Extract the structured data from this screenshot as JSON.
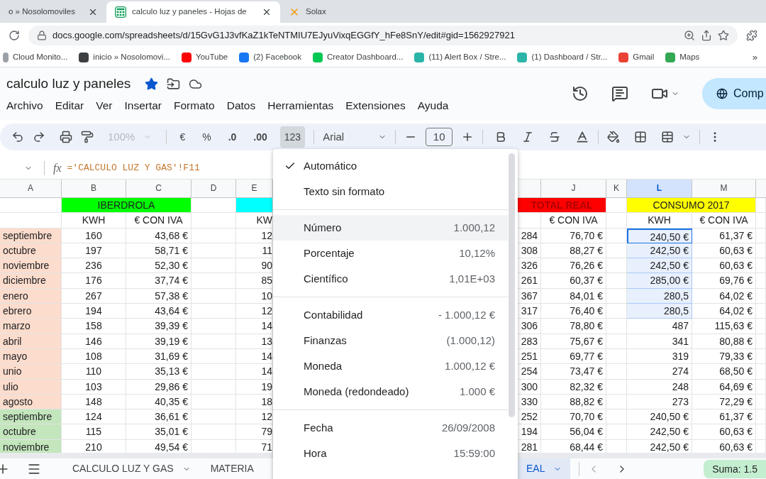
{
  "browser_tabs": [
    {
      "title": "o » Nosolomoviles",
      "selected": false
    },
    {
      "title": "calculo luz y paneles - Hojas de",
      "selected": true
    },
    {
      "title": "Solax",
      "selected": false
    }
  ],
  "address": "docs.google.com/spreadsheets/d/15GvG1J3vfKaZ1kTeNTMIU7EJyuVixqEGGfY_hFe8SnY/edit#gid=1562927921",
  "bookmarks": [
    {
      "label": "Cloud Monito...",
      "color": "#9aa0a6"
    },
    {
      "label": "inicio » Nosolomovi...",
      "color": "#3c4043"
    },
    {
      "label": "YouTube",
      "color": "#ff0000"
    },
    {
      "label": "(2) Facebook",
      "color": "#1877f2"
    },
    {
      "label": "Creator Dashboard...",
      "color": "#00c853"
    },
    {
      "label": "(11) Alert Box / Stre...",
      "color": "#2bb5a8"
    },
    {
      "label": "(1) Dashboard / Str...",
      "color": "#2bb5a8"
    },
    {
      "label": "Gmail",
      "color": "#ea4335"
    },
    {
      "label": "Maps",
      "color": "#34a853"
    }
  ],
  "bookmarks_more": "»",
  "doc": {
    "title": "calculo luz y paneles",
    "starred": true,
    "share_label": "Comp"
  },
  "menu_bar": [
    "Archivo",
    "Editar",
    "Ver",
    "Insertar",
    "Formato",
    "Datos",
    "Herramientas",
    "Extensiones",
    "Ayuda"
  ],
  "toolbar": {
    "zoom": {
      "label": "100%",
      "disabled": true
    },
    "format_buttons": [
      {
        "label": "€",
        "selected": false
      },
      {
        "label": "%",
        "selected": false
      },
      {
        "label": ".0",
        "selected": false
      },
      {
        "label": ".00",
        "selected": false
      },
      {
        "label": "123",
        "selected": true
      }
    ],
    "font": "Arial",
    "font_size": "10"
  },
  "formula": "='CALCULO LUZ Y GAS'!F11",
  "columns_left": [
    "A",
    "B",
    "C",
    "D",
    "E"
  ],
  "fx_label": "fx",
  "columns_right": [
    {
      "label": "J",
      "selected": false
    },
    {
      "label": "K",
      "selected": false
    },
    {
      "label": "L",
      "selected": true
    },
    {
      "label": "M",
      "selected": false
    }
  ],
  "bands": [
    {
      "label": "IBERDROLA",
      "color": "#00ff00"
    },
    {
      "color": "#00ffff"
    },
    {
      "label": "TOTAL REAL",
      "color": "#ff0000"
    },
    {
      "label": "CONSUMO 2017",
      "color": "#ffff00"
    }
  ],
  "subheaders": {
    "b": "KWH",
    "c": "€ CON IVA",
    "e": "KW",
    "j": "€ CON IVA",
    "l": "KWH",
    "m": "€ CON IVA"
  },
  "rows": [
    {
      "month": "septiembre",
      "color": "#fcdccc",
      "b": "160",
      "c": "43,68 €",
      "e": "12",
      "i": "284",
      "j": "76,70 €",
      "l": "240,50 €",
      "m": "61,37 €",
      "l_selected": true,
      "l_active": true
    },
    {
      "month": "octubre",
      "color": "#fcdccc",
      "b": "197",
      "c": "58,71 €",
      "e": "11",
      "i": "308",
      "j": "88,27 €",
      "l": "242,50 €",
      "m": "60,63 €",
      "l_selected": true,
      "l_active": false
    },
    {
      "month": "noviembre",
      "color": "#fcdccc",
      "b": "236",
      "c": "52,30 €",
      "e": "90",
      "i": "326",
      "j": "76,26 €",
      "l": "242,50 €",
      "m": "60,63 €",
      "l_selected": true,
      "l_active": false
    },
    {
      "month": "diciembre",
      "color": "#fcdccc",
      "b": "176",
      "c": "37,74 €",
      "e": "85",
      "i": "261",
      "j": "60,37 €",
      "l": "285,00 €",
      "m": "69,76 €",
      "l_selected": true,
      "l_active": false
    },
    {
      "month": "enero",
      "color": "#fcdccc",
      "b": "267",
      "c": "57,38 €",
      "e": "10",
      "i": "367",
      "j": "84,01 €",
      "l": "280,5",
      "m": "64,02 €",
      "l_selected": true,
      "l_active": false
    },
    {
      "month": "ebrero",
      "color": "#fcdccc",
      "b": "194",
      "c": "43,64 €",
      "e": "12",
      "i": "317",
      "j": "76,40 €",
      "l": "280,5",
      "m": "64,02 €",
      "l_selected": true,
      "l_active": false
    },
    {
      "month": "marzo",
      "color": "#fcdccc",
      "b": "158",
      "c": "39,39 €",
      "e": "14",
      "i": "306",
      "j": "78,80 €",
      "l": "487",
      "m": "115,63 €",
      "l_selected": false,
      "l_active": false
    },
    {
      "month": "abril",
      "color": "#fcdccc",
      "b": "146",
      "c": "39,19 €",
      "e": "13",
      "i": "283",
      "j": "75,67 €",
      "l": "341",
      "m": "80,88 €",
      "l_selected": false,
      "l_active": false
    },
    {
      "month": "mayo",
      "color": "#fcdccc",
      "b": "108",
      "c": "31,69 €",
      "e": "14",
      "i": "251",
      "j": "69,77 €",
      "l": "319",
      "m": "79,33 €",
      "l_selected": false,
      "l_active": false
    },
    {
      "month": "unio",
      "color": "#fcdccc",
      "b": "110",
      "c": "35,13 €",
      "e": "14",
      "i": "254",
      "j": "73,47 €",
      "l": "274",
      "m": "68,50 €",
      "l_selected": false,
      "l_active": false
    },
    {
      "month": "ulio",
      "color": "#fcdccc",
      "b": "103",
      "c": "29,86 €",
      "e": "19",
      "i": "300",
      "j": "82,32 €",
      "l": "248",
      "m": "64,69 €",
      "l_selected": false,
      "l_active": false
    },
    {
      "month": "agosto",
      "color": "#fcdccc",
      "b": "148",
      "c": "40,35 €",
      "e": "18",
      "i": "330",
      "j": "88,82 €",
      "l": "273",
      "m": "72,29 €",
      "l_selected": false,
      "l_active": false
    },
    {
      "month": "septiembre",
      "color": "#c3e6bc",
      "b": "124",
      "c": "36,61 €",
      "e": "12",
      "i": "252",
      "j": "70,70 €",
      "l": "240,50 €",
      "m": "61,37 €",
      "l_selected": false,
      "l_active": false
    },
    {
      "month": "octubre",
      "color": "#c3e6bc",
      "b": "115",
      "c": "35,01 €",
      "e": "79",
      "i": "194",
      "j": "56,04 €",
      "l": "242,50 €",
      "m": "60,63 €",
      "l_selected": false,
      "l_active": false
    },
    {
      "month": "noviembre",
      "color": "#c3e6bc",
      "b": "210",
      "c": "49,54 €",
      "e": "71",
      "i": "281",
      "j": "68,44 €",
      "l": "242,50 €",
      "m": "60,63 €",
      "l_selected": false,
      "l_active": false
    }
  ],
  "format_menu": {
    "sections": [
      [
        {
          "label": "Automático",
          "checked": true,
          "highlighted": false
        },
        {
          "label": "Texto sin formato",
          "checked": false,
          "highlighted": false
        }
      ],
      [
        {
          "label": "Número",
          "example": "1.000,12",
          "checked": false,
          "highlighted": true
        },
        {
          "label": "Porcentaje",
          "example": "10,12%",
          "checked": false,
          "highlighted": false
        },
        {
          "label": "Científico",
          "example": "1,01E+03",
          "checked": false,
          "highlighted": false
        }
      ],
      [
        {
          "label": "Contabilidad",
          "example": "- 1.000,12 €",
          "checked": false,
          "highlighted": false
        },
        {
          "label": "Finanzas",
          "example": "(1.000,12)",
          "checked": false,
          "highlighted": false
        },
        {
          "label": "Moneda",
          "example": "1.000,12 €",
          "checked": false,
          "highlighted": false
        },
        {
          "label": "Moneda (redondeado)",
          "example": "1.000 €",
          "checked": false,
          "highlighted": false
        }
      ],
      [
        {
          "label": "Fecha",
          "example": "26/09/2008",
          "checked": false,
          "highlighted": false
        },
        {
          "label": "Hora",
          "example": "15:59:00",
          "checked": false,
          "highlighted": false
        }
      ]
    ]
  },
  "sheet_tabs": [
    {
      "label": "CALCULO LUZ Y GAS",
      "selected": false
    },
    {
      "label": "MATERIA",
      "selected": false
    },
    {
      "label": "EAL",
      "selected": true
    }
  ],
  "sum_label": "Suma: 1.5"
}
